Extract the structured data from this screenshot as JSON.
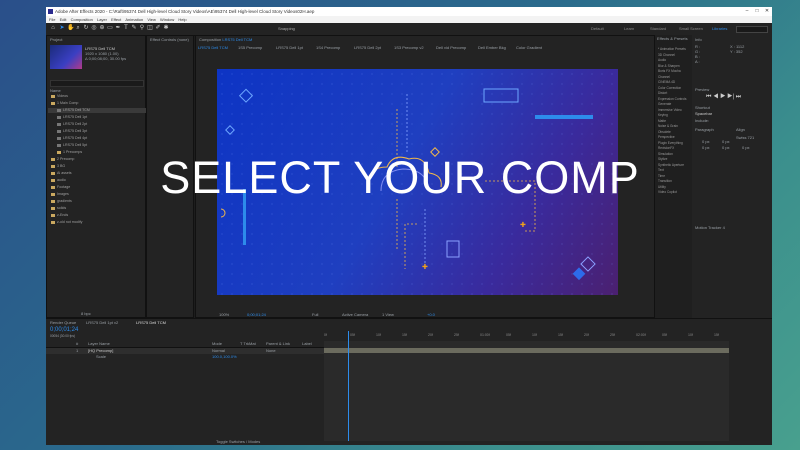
{
  "window": {
    "title": "Adobe After Effects 2020 - C:\\Raft\\95374 Dell High-level Cloud Story Videos\\AE\\95374 Dell High-level Cloud Story Videos02H.aep",
    "minimize": "–",
    "maximize": "□",
    "close": "✕"
  },
  "menu": [
    "File",
    "Edit",
    "Composition",
    "Layer",
    "Effect",
    "Animation",
    "View",
    "Window",
    "Help"
  ],
  "toolbar": {
    "snapping_label": "Snapping",
    "workspaces": [
      "Default",
      "Learn",
      "Standard",
      "Small Screen",
      "Libraries"
    ],
    "search_placeholder": "Search Help"
  },
  "project": {
    "tab": "Project",
    "comp_name": "LRS75 Dell TCM",
    "comp_info": "1920 x 1080 (1.00)",
    "comp_info2": "Δ 0;00;08;00, 30.00 fps",
    "column_name": "Name",
    "items": [
      {
        "label": "Videos",
        "type": "folder",
        "indent": 0
      },
      {
        "label": "1 Main Comp",
        "type": "folder",
        "indent": 0
      },
      {
        "label": "LRS75 Dell TCM",
        "type": "comp",
        "indent": 1,
        "selected": true
      },
      {
        "label": "LRS75 Dell 1pt",
        "type": "comp",
        "indent": 1
      },
      {
        "label": "LRS75 Dell 2pt",
        "type": "comp",
        "indent": 1
      },
      {
        "label": "LRS75 Dell 3pt",
        "type": "comp",
        "indent": 1
      },
      {
        "label": "LRS75 Dell 4pt",
        "type": "comp",
        "indent": 1
      },
      {
        "label": "LRS75 Dell 5pt",
        "type": "comp",
        "indent": 1
      },
      {
        "label": "1 Precomps",
        "type": "folder",
        "indent": 1
      },
      {
        "label": "2 Precomp",
        "type": "folder",
        "indent": 0
      },
      {
        "label": "3 BG",
        "type": "folder",
        "indent": 0
      },
      {
        "label": "Ai assets",
        "type": "folder",
        "indent": 0
      },
      {
        "label": "audio",
        "type": "folder",
        "indent": 0
      },
      {
        "label": "Footage",
        "type": "folder",
        "indent": 0
      },
      {
        "label": "Images",
        "type": "folder",
        "indent": 0
      },
      {
        "label": "gradients",
        "type": "folder",
        "indent": 0
      },
      {
        "label": "solids",
        "type": "folder",
        "indent": 0
      },
      {
        "label": "z-Ends",
        "type": "folder",
        "indent": 0
      },
      {
        "label": "z-old not modify",
        "type": "folder",
        "indent": 0
      }
    ],
    "footer_bpc": "8 bpc"
  },
  "effects_controls": {
    "tab": "Effect Controls (none)"
  },
  "composition": {
    "tab": "Composition",
    "comp_link": "LRS75 Dell TCM",
    "view_tabs": [
      "LRS75 Dell TCM",
      "1S5 Precomp",
      "LRS75 Dell 1pt",
      "1S4 Precomp",
      "LRS75 Dell 2pt",
      "1S3 Precomp v2",
      "Dell vid Precomp",
      "Dell Ember Bkg",
      "Color Gradient"
    ],
    "zoom": "100%",
    "quality": "Full",
    "timecode": "0;00;01;24",
    "camera": "Active Camera",
    "views": "1 View",
    "offset": "+0.0"
  },
  "overlay_text": "SELECT YOUR COMP",
  "effects_panel": {
    "tab": "Effects & Presets",
    "items": [
      "* Animation Presets",
      "3D Channel",
      "Audio",
      "Blur & Sharpen",
      "Boris FX Mocha",
      "Channel",
      "CINEMA 4D",
      "Color Correction",
      "Distort",
      "Expression Controls",
      "Generate",
      "Immersive Video",
      "Keying",
      "Matte",
      "Noise & Grain",
      "Obsolete",
      "Perspective",
      "Plugin Everything",
      "RevisionFX",
      "Simulation",
      "Stylize",
      "Synthetic Aperture",
      "Text",
      "Time",
      "Transition",
      "Utility",
      "Video Copilot"
    ]
  },
  "info_panel": {
    "tab": "Info",
    "r": "R :",
    "g": "G :",
    "b": "B :",
    "a": "A :",
    "x": "X : 1112",
    "y": "Y : 352"
  },
  "preview_panel": {
    "tab": "Preview",
    "shortcut_label": "Shortcut",
    "shortcut_value": "Spacebar",
    "include": "Include:"
  },
  "character_panel": {
    "tab": "Character",
    "font": "Swiss 721",
    "align_tab": "Align"
  },
  "paragraph_panel": {
    "tab": "Paragraph",
    "values": [
      "0 px",
      "0 px",
      "0 px",
      "0 px",
      "0 px"
    ]
  },
  "tracker_panel": {
    "tab": "Motion Tracker 4"
  },
  "timeline": {
    "tabs": [
      "Render Queue",
      "LRS75 Dell 1pt v2",
      "LRS75 Dell TCM"
    ],
    "timecode": "0;00;01;24",
    "fps_note": "00054 (30.00 fps)",
    "columns": [
      "#",
      "Layer Name",
      "Mode",
      "T TrkMat",
      "Parent & Link",
      "Label"
    ],
    "layers": [
      {
        "num": "1",
        "name": "[HQ Precomp]",
        "mode": "Normal",
        "parent": "None"
      },
      {
        "num": "",
        "name": "Scale",
        "mode": "",
        "parent": "100.0,100.0%"
      }
    ],
    "ruler": [
      "0f",
      "05f",
      "10f",
      "15f",
      "20f",
      "25f",
      "01:00f",
      "05f",
      "10f",
      "15f",
      "20f",
      "25f",
      "02:00f",
      "05f",
      "10f",
      "15f"
    ],
    "footer_toggle": "Toggle Switches / Modes"
  },
  "colors": {
    "accent": "#2d8ceb",
    "viewer_blue": "#1f3fc0",
    "orange": "#e8a31a"
  }
}
